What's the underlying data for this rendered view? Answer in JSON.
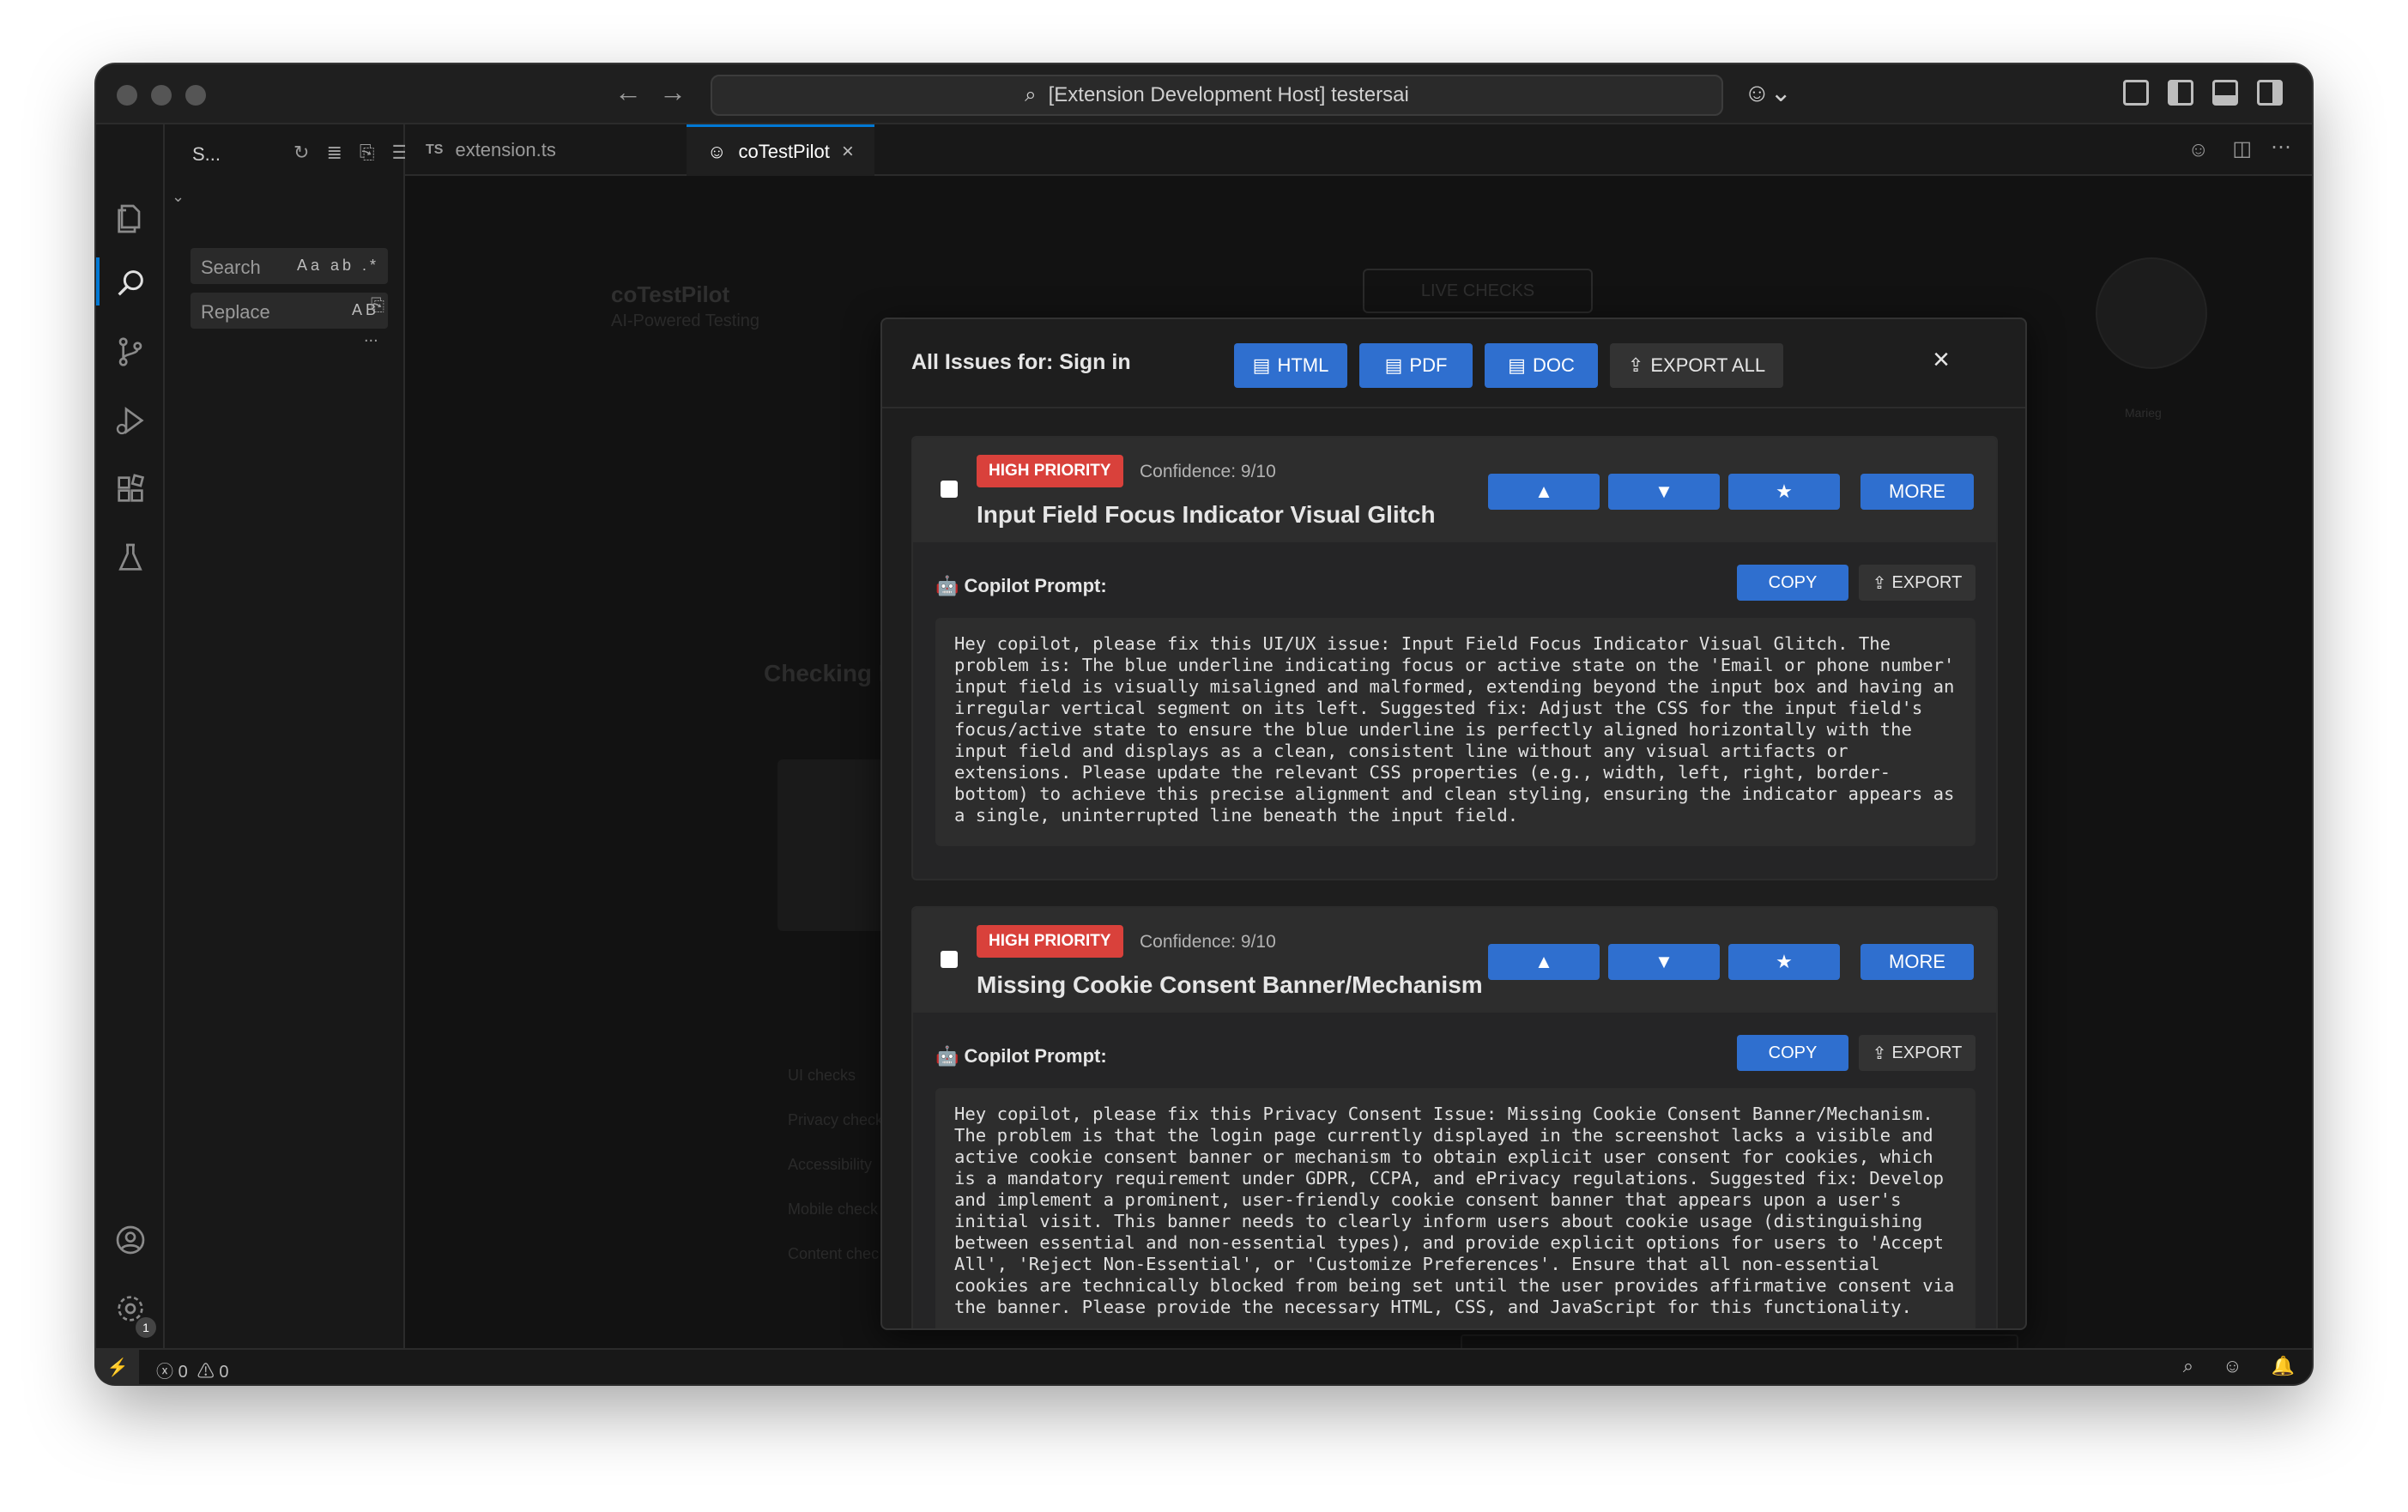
{
  "window": {
    "command_center": "[Extension Development Host] testersai"
  },
  "sidebar": {
    "title": "S...",
    "search_placeholder": "Search",
    "search_opts": "Aa ab .*",
    "replace_placeholder": "Replace",
    "replace_opts": "AB",
    "more": "..."
  },
  "tabs": [
    {
      "prefix": "TS",
      "label": "extension.ts"
    },
    {
      "label": "coTestPilot"
    }
  ],
  "background": {
    "app_title": "coTestPilot",
    "app_sub": "AI-Powered Testing",
    "live_checks": "LIVE CHECKS",
    "checking": "Checking P",
    "avatar_name": "Marieg",
    "list": [
      "UI checks",
      "Privacy check",
      "Accessibility",
      "Mobile check",
      "Content chec"
    ]
  },
  "modal": {
    "title": "All Issues for: Sign in",
    "buttons": {
      "html": "HTML",
      "pdf": "PDF",
      "doc": "DOC",
      "export_all": "EXPORT ALL"
    },
    "close": "×"
  },
  "issues": [
    {
      "priority": "HIGH PRIORITY",
      "confidence": "Confidence: 9/10",
      "title": "Input Field Focus Indicator Visual Glitch",
      "up": "▲",
      "down": "▼",
      "star": "★",
      "more": "MORE",
      "prompt_label": "Copilot Prompt:",
      "copy": "COPY",
      "export": "EXPORT",
      "prompt": "Hey copilot, please fix this UI/UX issue: Input Field Focus Indicator Visual Glitch. The problem is: The blue underline indicating focus or active state on the 'Email or phone number' input field is visually misaligned and malformed, extending beyond the input box and having an irregular vertical segment on its left. Suggested fix: Adjust the CSS for the input field's focus/active state to ensure the blue underline is perfectly aligned horizontally with the input field and displays as a clean, consistent line without any visual artifacts or extensions. Please update the relevant CSS properties (e.g., width, left, right, border-bottom) to achieve this precise alignment and clean styling, ensuring the indicator appears as a single, uninterrupted line beneath the input field."
    },
    {
      "priority": "HIGH PRIORITY",
      "confidence": "Confidence: 9/10",
      "title": "Missing Cookie Consent Banner/Mechanism",
      "up": "▲",
      "down": "▼",
      "star": "★",
      "more": "MORE",
      "prompt_label": "Copilot Prompt:",
      "copy": "COPY",
      "export": "EXPORT",
      "prompt": "Hey copilot, please fix this Privacy Consent Issue: Missing Cookie Consent Banner/Mechanism. The problem is that the login page currently displayed in the screenshot lacks a visible and active cookie consent banner or mechanism to obtain explicit user consent for cookies, which is a mandatory requirement under GDPR, CCPA, and ePrivacy regulations. Suggested fix: Develop and implement a prominent, user-friendly cookie consent banner that appears upon a user's initial visit. This banner needs to clearly inform users about cookie usage (distinguishing between essential and non-essential types), and provide explicit options for users to 'Accept All', 'Reject Non-Essential', or 'Customize Preferences'. Ensure that all non-essential cookies are technically blocked from being set until the user provides affirmative consent via the banner. Please provide the necessary HTML, CSS, and JavaScript for this functionality."
    }
  ],
  "statusbar": {
    "errors": "0",
    "warnings": "0",
    "badge": "1"
  }
}
